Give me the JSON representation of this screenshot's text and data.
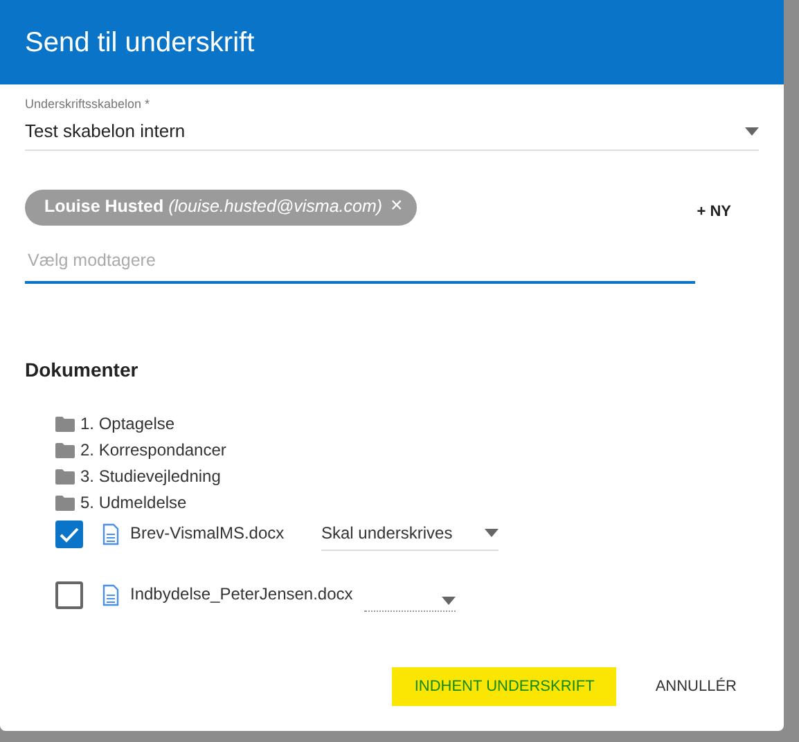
{
  "dialog": {
    "title": "Send til underskrift"
  },
  "template_field": {
    "label": "Underskriftsskabelon *",
    "value": "Test skabelon intern"
  },
  "recipients": {
    "chips": [
      {
        "name": "Louise Husted",
        "email": "(louise.husted@visma.com)",
        "remove": "×"
      }
    ],
    "placeholder": "Vælg modtagere",
    "new_button": "+ NY"
  },
  "documents": {
    "heading": "Dokumenter",
    "items": [
      {
        "kind": "folder",
        "label": "1. Optagelse"
      },
      {
        "kind": "folder",
        "label": "2. Korrespondancer"
      },
      {
        "kind": "folder",
        "label": "3. Studievejledning"
      },
      {
        "kind": "folder",
        "label": "5. Udmeldelse"
      },
      {
        "kind": "file",
        "label": "Brev-VismalMS.docx",
        "checked": true,
        "action": "Skal underskrives"
      },
      {
        "kind": "file",
        "label": "Indbydelse_PeterJensen.docx",
        "checked": false
      }
    ]
  },
  "buttons": [
    {
      "label": "INDHENT UNDERSKRIFT",
      "kind": "primary",
      "highlighted": true
    },
    {
      "label": "ANNULLÉR",
      "kind": "secondary",
      "highlighted": false
    }
  ]
}
